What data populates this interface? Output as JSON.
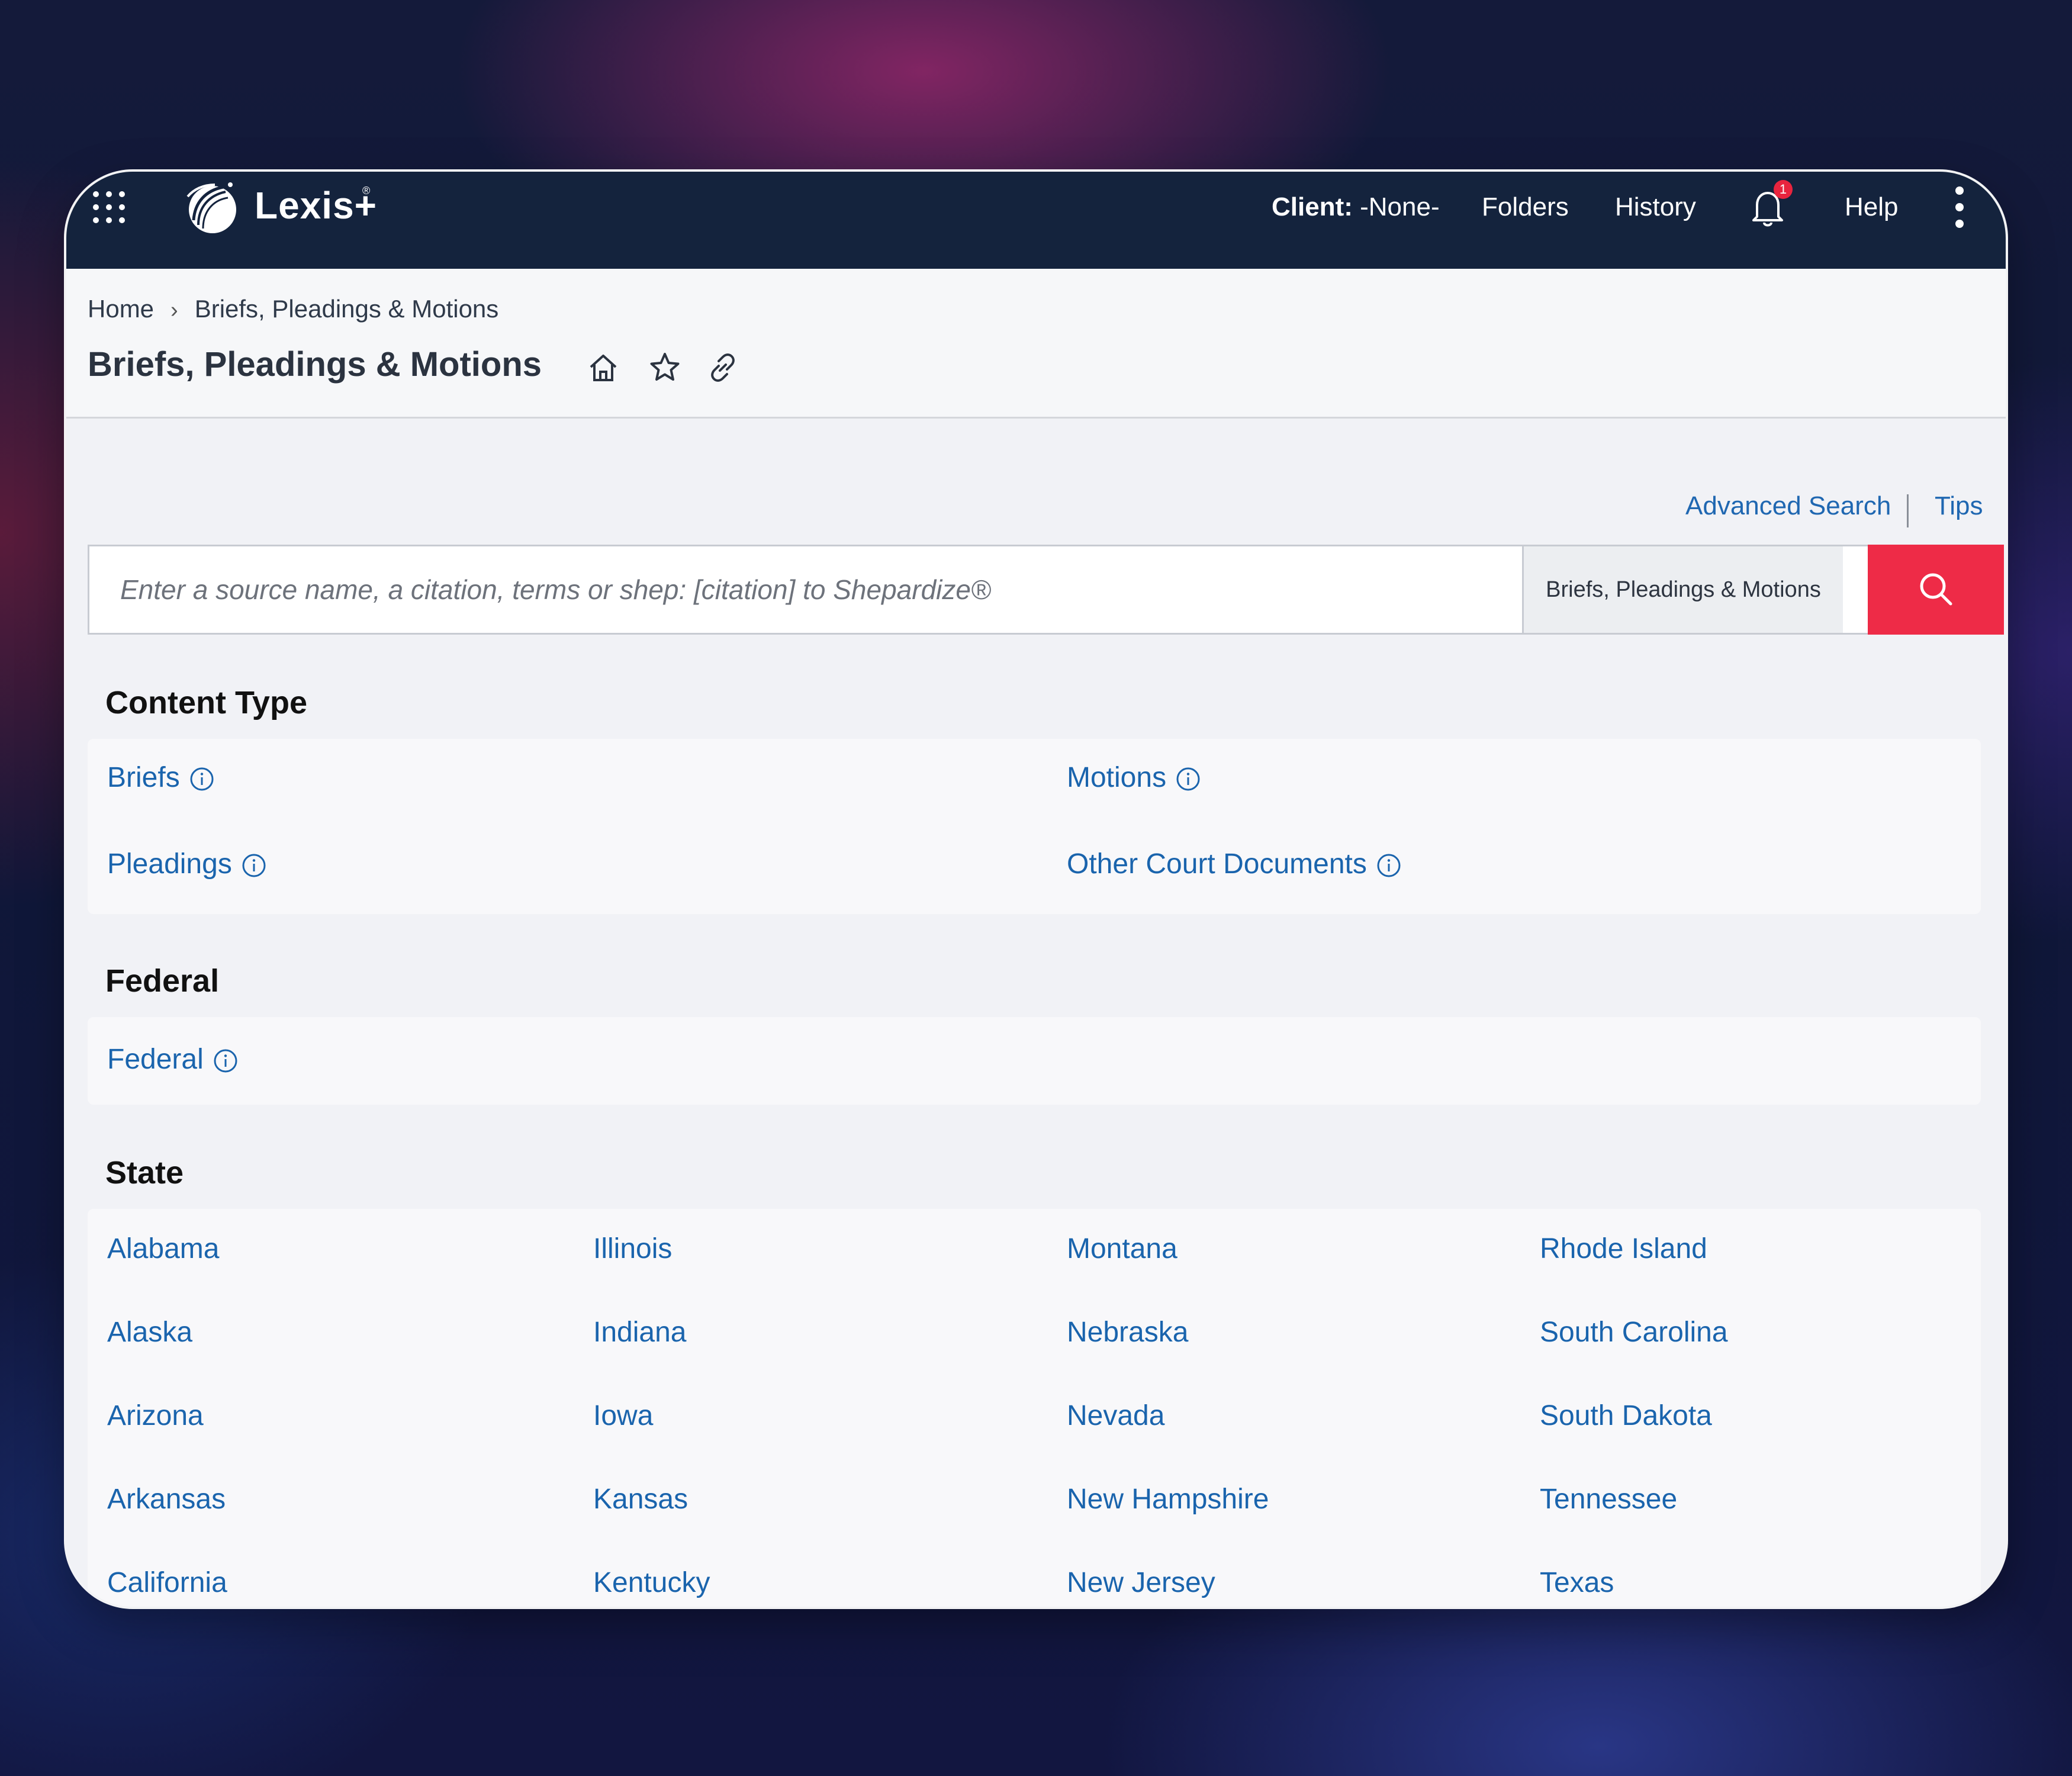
{
  "topbar": {
    "brand": "Lexis+",
    "brand_mark": "®",
    "client_label": "Client:",
    "client_value": "-None-",
    "folders": "Folders",
    "history": "History",
    "notification_count": "1",
    "help": "Help"
  },
  "breadcrumb": {
    "home": "Home",
    "current": "Briefs, Pleadings & Motions"
  },
  "page_title": "Briefs, Pleadings & Motions",
  "search": {
    "advanced": "Advanced Search",
    "tips": "Tips",
    "placeholder": "Enter a source name, a citation, terms or shep: [citation] to Shepardize®",
    "scope": "Briefs, Pleadings & Motions"
  },
  "content_type": {
    "title": "Content Type",
    "items": [
      "Briefs",
      "Motions",
      "Pleadings",
      "Other Court Documents"
    ]
  },
  "federal": {
    "title": "Federal",
    "items": [
      "Federal"
    ]
  },
  "state": {
    "title": "State",
    "col1": [
      "Alabama",
      "Alaska",
      "Arizona",
      "Arkansas",
      "California"
    ],
    "col2": [
      "Illinois",
      "Indiana",
      "Iowa",
      "Kansas",
      "Kentucky"
    ],
    "col3": [
      "Montana",
      "Nebraska",
      "Nevada",
      "New Hampshire",
      "New Jersey"
    ],
    "col4": [
      "Rhode Island",
      "South Carolina",
      "South Dakota",
      "Tennessee",
      "Texas"
    ]
  },
  "colors": {
    "topbar": "#14233d",
    "link": "#1a64ad",
    "search_button": "#ee2b47",
    "badge": "#e8243e"
  },
  "icons": [
    "apps-grid-icon",
    "lexis-logo-icon",
    "bell-icon",
    "kebab-menu-icon",
    "home-icon",
    "star-icon",
    "link-icon",
    "search-icon",
    "info-icon"
  ]
}
